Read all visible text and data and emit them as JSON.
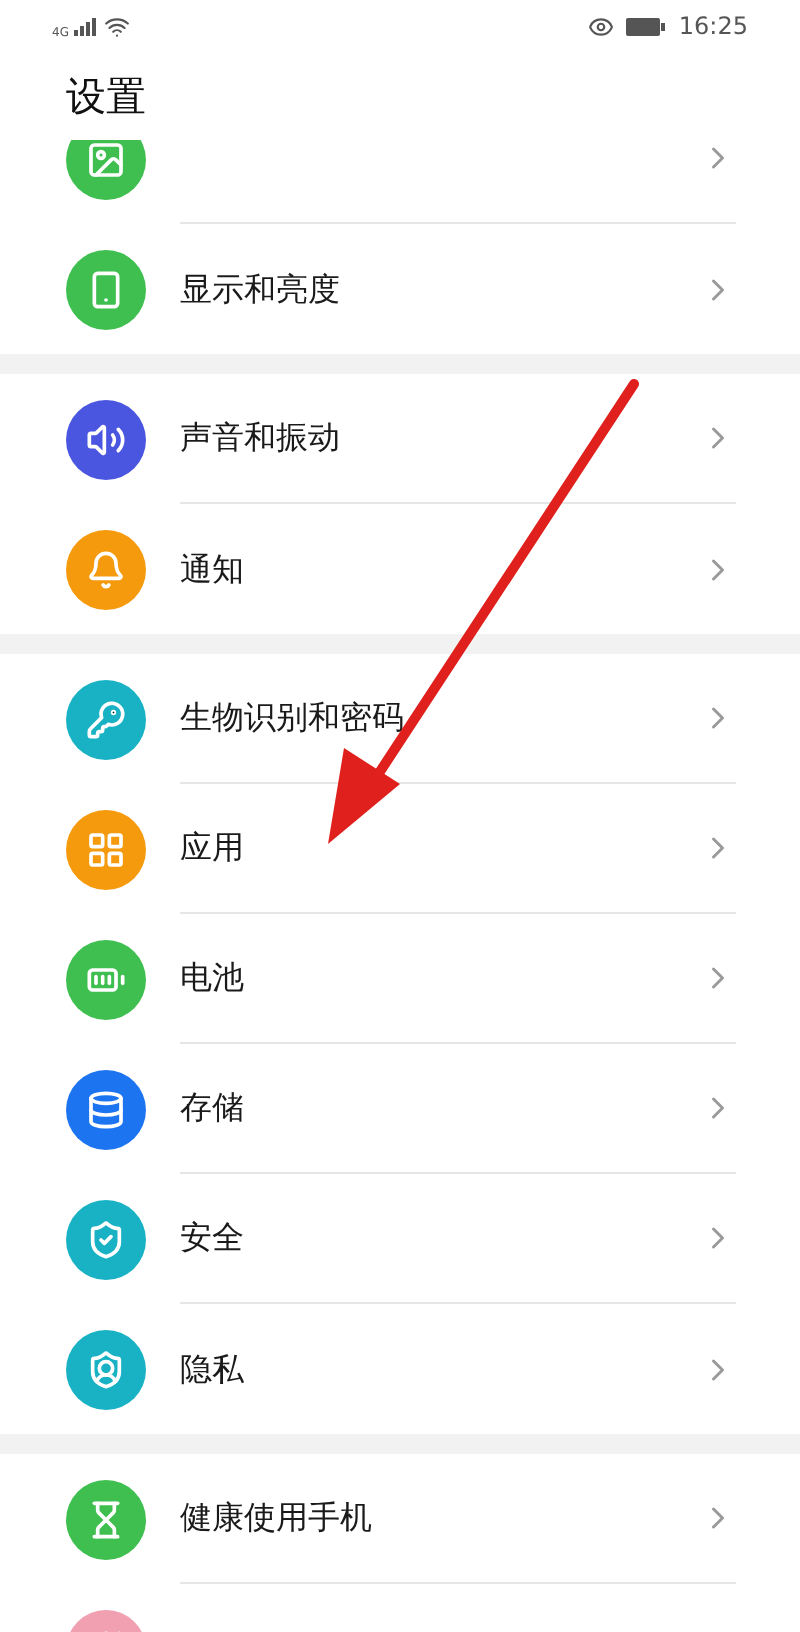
{
  "status_bar": {
    "network": "4G",
    "time": "16:25"
  },
  "title": "设置",
  "groups": [
    {
      "items": [
        {
          "color": "#3fbf4f"
        },
        {
          "label": "显示和亮度",
          "color": "#3fbf4f"
        }
      ]
    },
    {
      "items": [
        {
          "label": "声音和振动",
          "color": "#4a56e0"
        },
        {
          "label": "通知",
          "color": "#f59a0c"
        }
      ]
    },
    {
      "items": [
        {
          "label": "生物识别和密码",
          "color": "#18b2c4"
        },
        {
          "label": "应用",
          "color": "#f59a0c"
        },
        {
          "label": "电池",
          "color": "#3fbf4f"
        },
        {
          "label": "存储",
          "color": "#1c74f0"
        },
        {
          "label": "安全",
          "color": "#18b2c4"
        },
        {
          "label": "隐私",
          "color": "#18b2c4"
        }
      ]
    },
    {
      "items": [
        {
          "label": "健康使用手机",
          "color": "#3fbf4f"
        },
        {
          "color": "#f0a0b0"
        }
      ]
    }
  ]
}
